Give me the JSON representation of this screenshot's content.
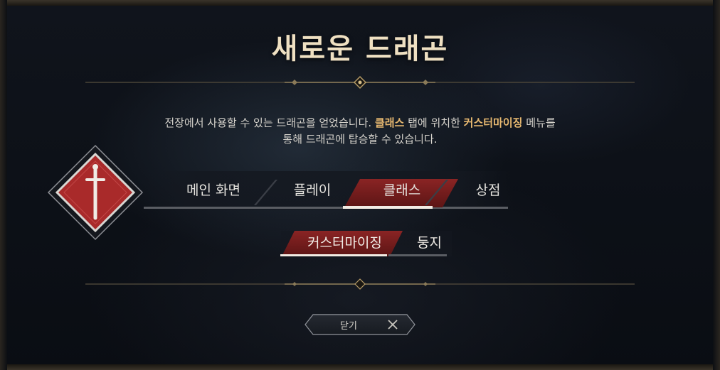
{
  "dialog": {
    "title": "새로운 드래곤",
    "message": {
      "line1_part1": "전장에서 사용할 수 있는 드래곤을 얻었습니다. ",
      "line1_highlight1": "클래스",
      "line1_part2": " 탭에 위치한 ",
      "line1_highlight2": "커스터마이징",
      "line1_part3": " 메뉴를",
      "line2": "통해 드래곤에 탑승할 수 있습니다."
    },
    "highlight_color": "#e7b870",
    "accent_red": "#8a2424"
  },
  "tabs": [
    {
      "label": "메인 화면",
      "active": false
    },
    {
      "label": "플레이",
      "active": false
    },
    {
      "label": "클래스",
      "active": true
    },
    {
      "label": "상점",
      "active": false
    }
  ],
  "subtabs": [
    {
      "label": "커스터마이징",
      "active": true
    },
    {
      "label": "둥지",
      "active": false
    }
  ],
  "close_button": {
    "label": "닫기",
    "icon": "close-icon"
  },
  "emblem": {
    "icon": "sword-emblem-icon"
  }
}
